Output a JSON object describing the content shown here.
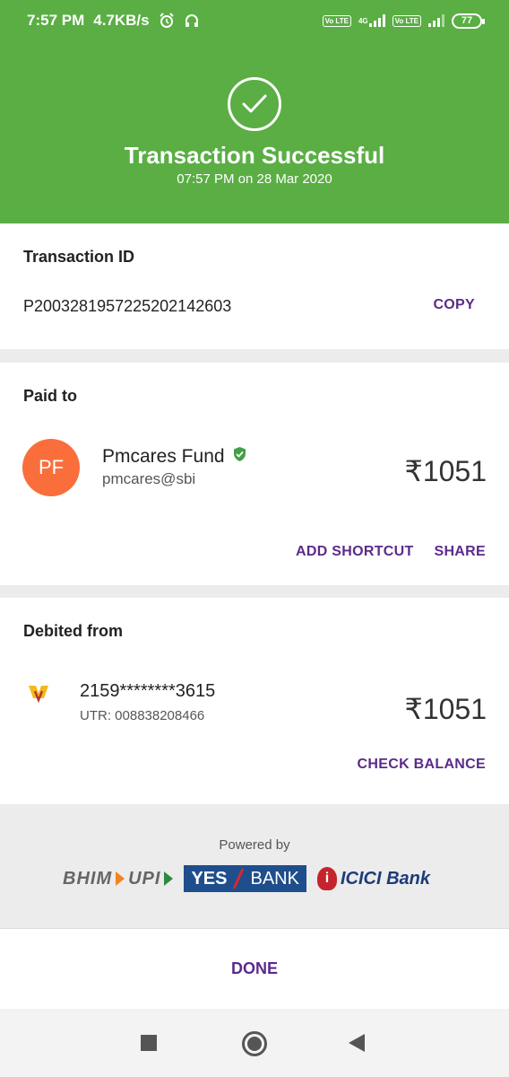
{
  "status_bar": {
    "time": "7:57 PM",
    "speed": "4.7KB/s",
    "network_label": "4G",
    "volte_label": "Vo LTE",
    "battery": "77"
  },
  "header": {
    "title": "Transaction Successful",
    "subtitle": "07:57 PM on 28 Mar 2020"
  },
  "transaction": {
    "label": "Transaction ID",
    "id": "P2003281957225202142603",
    "copy_label": "COPY"
  },
  "paid_to": {
    "label": "Paid to",
    "avatar_initials": "PF",
    "name": "Pmcares Fund",
    "vpa": "pmcares@sbi",
    "amount": "₹1051",
    "add_shortcut_label": "ADD SHORTCUT",
    "share_label": "SHARE"
  },
  "debited_from": {
    "label": "Debited from",
    "account": "2159********3615",
    "utr": "UTR: 008838208466",
    "amount": "₹1051",
    "check_balance_label": "CHECK BALANCE"
  },
  "powered_by": {
    "label": "Powered by",
    "logos": {
      "bhim": "BHIM",
      "upi": "UPI",
      "yes_bank": "YES",
      "yes_bank_suffix": "BANK",
      "icici": "ICICI Bank"
    }
  },
  "footer": {
    "done_label": "DONE"
  },
  "colors": {
    "header_green": "#5aae44",
    "accent_purple": "#5b2b8a",
    "avatar_orange": "#fa6e3c",
    "verified_green": "#43a047"
  }
}
